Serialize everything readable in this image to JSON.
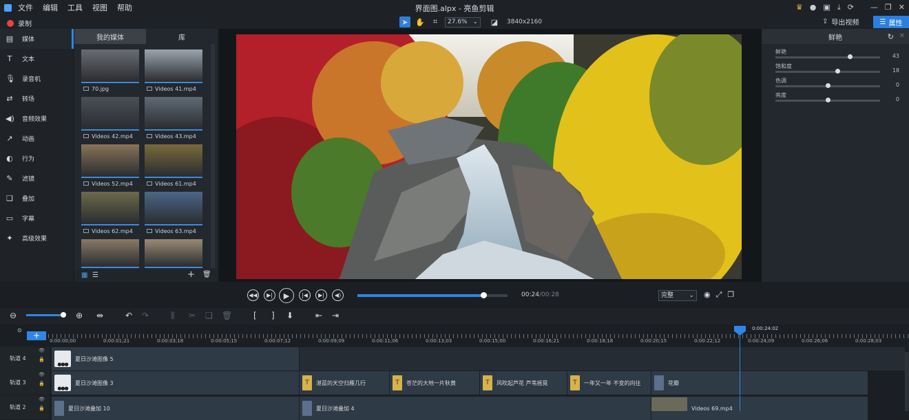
{
  "menu": {
    "items": [
      "文件",
      "编辑",
      "工具",
      "视图",
      "帮助"
    ]
  },
  "window": {
    "title": "界面图.alpx - 亮鱼剪辑"
  },
  "toolbar": {
    "record_label": "录制",
    "zoom": "27.6%",
    "resolution": "3840x2160",
    "export_label": "导出视频",
    "properties_label": "属性"
  },
  "sidebar": {
    "items": [
      {
        "label": "媒体",
        "icon": "media-icon"
      },
      {
        "label": "文本",
        "icon": "text-icon"
      },
      {
        "label": "录音机",
        "icon": "microphone-icon"
      },
      {
        "label": "转场",
        "icon": "transition-icon"
      },
      {
        "label": "音频效果",
        "icon": "audio-effect-icon"
      },
      {
        "label": "动画",
        "icon": "animation-icon"
      },
      {
        "label": "行为",
        "icon": "behavior-icon"
      },
      {
        "label": "滤镜",
        "icon": "filter-icon"
      },
      {
        "label": "叠加",
        "icon": "overlay-icon"
      },
      {
        "label": "字幕",
        "icon": "subtitle-icon"
      },
      {
        "label": "高级效果",
        "icon": "advanced-effect-icon"
      }
    ]
  },
  "media": {
    "tabs": [
      "我的媒体",
      "库"
    ],
    "items": [
      {
        "name": "70.jpg",
        "color": "#6a6c74"
      },
      {
        "name": "Videos 41.mp4",
        "color": "#9aa4ae"
      },
      {
        "name": "Videos 42.mp4",
        "color": "#4a4f57"
      },
      {
        "name": "Videos 43.mp4",
        "color": "#5f6a74"
      },
      {
        "name": "Videos 52.mp4",
        "color": "#8a7358"
      },
      {
        "name": "Videos 61.mp4",
        "color": "#7a6a3a"
      },
      {
        "name": "Videos 62.mp4",
        "color": "#6c6a4a"
      },
      {
        "name": "Videos 63.mp4",
        "color": "#4c6688"
      },
      {
        "name": "",
        "color": "#8a7a66"
      },
      {
        "name": "",
        "color": "#9a8a74"
      }
    ]
  },
  "properties": {
    "title": "鲜艳",
    "sliders": [
      {
        "label": "鲜艳",
        "value": "43",
        "fraction": 0.71
      },
      {
        "label": "饱和度",
        "value": "18",
        "fraction": 0.59
      },
      {
        "label": "色调",
        "value": "0",
        "fraction": 0.5
      },
      {
        "label": "亮度",
        "value": "0",
        "fraction": 0.5
      }
    ]
  },
  "playback": {
    "current": "00:24",
    "total": "/00:28",
    "progress": 0.84,
    "quality": "完整"
  },
  "timeline": {
    "playhead_time": "0:00:24:02",
    "ruler": [
      "0:00:00;00",
      "0:00:01;21",
      "0:00:03;18",
      "0:00:05;15",
      "0:00:07;12",
      "0:00:09;09",
      "0:00:11;06",
      "0:00:13;03",
      "0:00:15;00",
      "0:00:16;21",
      "0:00:18;18",
      "0:00:20;15",
      "0:00:22;12",
      "0:00:24;09",
      "0:00:26;06",
      "0:00:28;03"
    ],
    "tracks": [
      {
        "name": "轨道 4",
        "clips": [
          {
            "label": "夏日沙滩图像 5"
          }
        ]
      },
      {
        "name": "轨道 3",
        "clips": [
          {
            "label": "夏日沙滩图像 3"
          },
          {
            "label": "湛蓝的天空归雁几行"
          },
          {
            "label": "苍茫的大地一片秋黄"
          },
          {
            "label": "风吹起芦花 芦苇摇晃"
          },
          {
            "label": "一年又一年 不变的向往"
          },
          {
            "label": "花瓣"
          }
        ]
      },
      {
        "name": "轨道 2",
        "clips": [
          {
            "label": "夏日沙滩叠加 10"
          },
          {
            "label": "夏日沙滩叠加 4"
          },
          {
            "label": "Videos 69.mp4"
          }
        ]
      }
    ]
  }
}
